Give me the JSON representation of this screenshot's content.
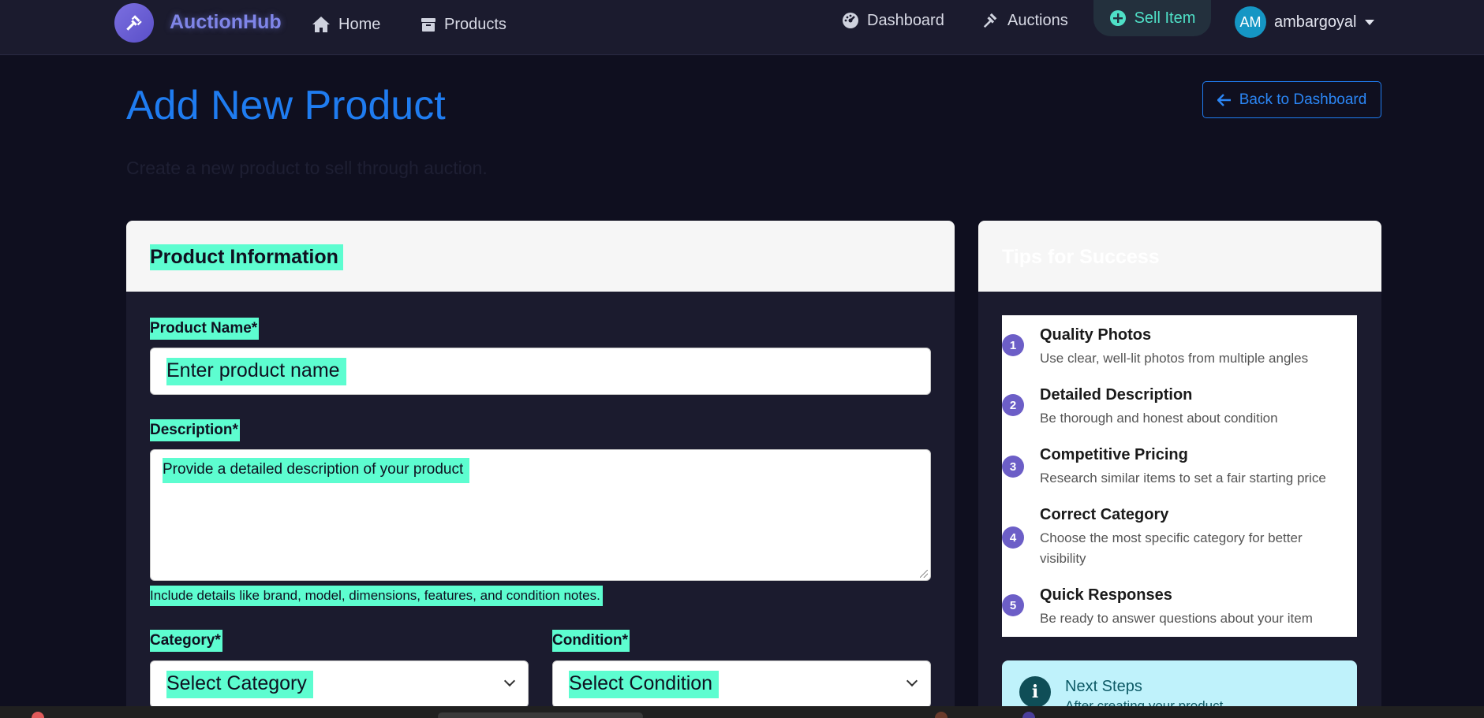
{
  "brand": {
    "name": "AuctionHub",
    "logo_icon": "gavel-icon",
    "accent": "#7f85e8"
  },
  "nav": {
    "home": "Home",
    "products": "Products",
    "dashboard": "Dashboard",
    "auctions": "Auctions",
    "sell": "Sell Item",
    "user": {
      "initials": "AM",
      "name": "ambargoyal"
    }
  },
  "header": {
    "title": "Add New Product",
    "subtitle": "Create a new product to sell through auction.",
    "back_label": "Back to Dashboard"
  },
  "form": {
    "card_title": "Product Information",
    "name_label": "Product Name*",
    "name_placeholder": "Enter product name",
    "description_label": "Description*",
    "description_placeholder": "Provide a detailed description of your product",
    "description_help": "Include details like brand, model, dimensions, features, and condition notes.",
    "category_label": "Category*",
    "category_value": "Select Category",
    "condition_label": "Condition*",
    "condition_value": "Select Condition"
  },
  "tips": {
    "title": "Tips for Success",
    "items": [
      {
        "num": "1",
        "title": "Quality Photos",
        "desc": "Use clear, well-lit photos from multiple angles"
      },
      {
        "num": "2",
        "title": "Detailed Description",
        "desc": "Be thorough and honest about condition"
      },
      {
        "num": "3",
        "title": "Competitive Pricing",
        "desc": "Research similar items to set a fair starting price"
      },
      {
        "num": "4",
        "title": "Correct Category",
        "desc": "Choose the most specific category for better visibility"
      },
      {
        "num": "5",
        "title": "Quick Responses",
        "desc": "Be ready to answer questions about your item"
      }
    ],
    "next_steps_title": "Next Steps",
    "next_steps_text": "After creating your product..."
  },
  "colors": {
    "primary": "#1f7cf0",
    "highlight": "#5dfdd0",
    "sell": "#4fe0c7",
    "tip_badge": "#6c5ec7"
  }
}
